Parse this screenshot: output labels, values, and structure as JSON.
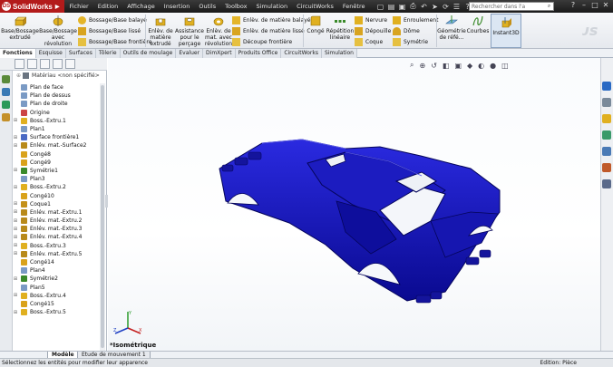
{
  "app": {
    "name": "SolidWorks",
    "colors": {
      "titlebar": "#1e1e1e",
      "logo": "#b31b1b",
      "model": "#1212aa",
      "selection": "#3a5fa8"
    }
  },
  "menu": [
    "Fichier",
    "Edition",
    "Affichage",
    "Insertion",
    "Outils",
    "Toolbox",
    "Simulation",
    "CircuitWorks",
    "Fenêtre"
  ],
  "search": {
    "placeholder": "Rechercher dans l'a"
  },
  "ribbon": {
    "base_extrude": "Base/Bossage extrudé",
    "base_revolve": "Base/Bossage avec révolution",
    "boss_swept": "Bossage/Base balayé",
    "boss_loft": "Bossage/Base lissé",
    "boss_boundary": "Bossage/Base frontière",
    "cut_extrude": "Enlèv. de matière extrudé",
    "hole_wizard": "Assistance pour le perçage",
    "cut_revolve": "Enlèv. de mat. avec révolution",
    "cut_swept": "Enlèv. de matière balayé",
    "cut_loft": "Enlèv. de matière lissé",
    "cut_boundary": "Découpe frontière",
    "fillet": "Congé",
    "linear_pattern": "Répétition linéaire",
    "rib": "Nervure",
    "draft": "Dépouille",
    "shell": "Coque",
    "wrap": "Enroulement",
    "dome": "Dôme",
    "mirror": "Symétrie",
    "ref_geometry": "Géométrie de réfé...",
    "curves": "Courbes",
    "instant3d": "Instant3D"
  },
  "tabs": [
    "Fonctions",
    "Esquisse",
    "Surfaces",
    "Tôlerie",
    "Outils de moulage",
    "Evaluer",
    "DimXpert",
    "Produits Office",
    "CircuitWorks",
    "Simulation"
  ],
  "tree": {
    "material": "Matériau <non spécifié>",
    "items": [
      "Plan de face",
      "Plan de dessus",
      "Plan de droite",
      "Origine",
      "Boss.-Extru.1",
      "Plan1",
      "Surface frontière1",
      "Enlév. mat.-Surface2",
      "Congé8",
      "Congé9",
      "Symétrie1",
      "Plan3",
      "Boss.-Extru.2",
      "Congé10",
      "Coque1",
      "Enlév. mat.-Extru.1",
      "Enlév. mat.-Extru.2",
      "Enlév. mat.-Extru.3",
      "Enlév. mat.-Extru.4",
      "Boss.-Extru.3",
      "Enlév. mat.-Extru.5",
      "Congé14",
      "Plan4",
      "Symétrie2",
      "Plan5",
      "Boss.-Extru.4",
      "Congé15",
      "Boss.-Extru.5"
    ]
  },
  "viewport": {
    "view_name": "*Isométrique"
  },
  "bottom_tabs": [
    "Modèle",
    "Etude de mouvement 1"
  ],
  "status": {
    "message": "Sélectionnez les entités pour modifier leur apparence",
    "mode": "Edition: Pièce"
  }
}
